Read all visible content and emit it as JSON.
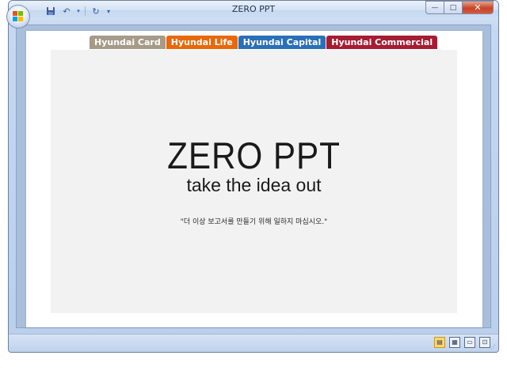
{
  "window": {
    "title": "ZERO PPT"
  },
  "qat": {
    "save_icon": "save-icon",
    "undo_icon": "undo-icon",
    "redo_icon": "redo-icon",
    "customize_icon": "customize-qat-icon"
  },
  "window_controls": {
    "minimize": "—",
    "maximize": "□",
    "close": "✕"
  },
  "tabs": [
    {
      "label": "Hyundai Card",
      "color": "#a59b88"
    },
    {
      "label": "Hyundai Life",
      "color": "#e8680a"
    },
    {
      "label": "Hyundai Capital",
      "color": "#2a6fb8"
    },
    {
      "label": "Hyundai Commercial",
      "color": "#a51c33"
    }
  ],
  "slide": {
    "headline": "ZERO PPT",
    "tagline": "take the idea out",
    "quote": "\"더 이상 보고서를 만들기 위해 일하지 마십시오.\""
  },
  "statusbar": {
    "views": [
      "normal-view-icon",
      "slide-sorter-icon",
      "slideshow-icon",
      "fit-to-window-icon"
    ]
  }
}
